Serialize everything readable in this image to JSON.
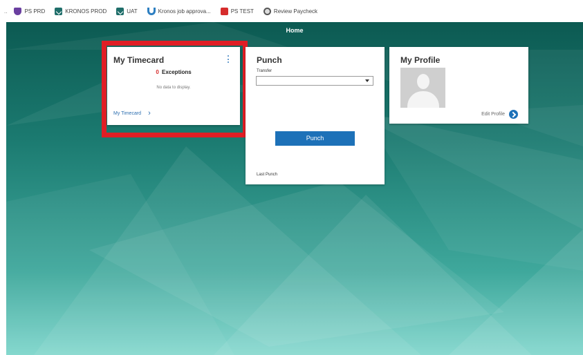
{
  "bookmarks": {
    "overflow": "..",
    "items": [
      {
        "label": "PS PRD",
        "icon": "shield-icon"
      },
      {
        "label": "KRONOS PROD",
        "icon": "kronos-icon"
      },
      {
        "label": "UAT",
        "icon": "kronos-icon"
      },
      {
        "label": "Kronos job approva...",
        "icon": "magnet-icon"
      },
      {
        "label": "PS TEST",
        "icon": "red-square-icon"
      },
      {
        "label": "Review Paycheck",
        "icon": "globe-icon"
      }
    ]
  },
  "header": {
    "title": "Home"
  },
  "timecard": {
    "title": "My Timecard",
    "exceptions_count": "0",
    "exceptions_label": "Exceptions",
    "no_data": "No data to display.",
    "link_label": "My Timecard",
    "link_chevron": "›"
  },
  "punch": {
    "title": "Punch",
    "transfer_label": "Transfer",
    "transfer_value": "",
    "button_label": "Punch",
    "last_punch_label": "Last Punch"
  },
  "profile": {
    "title": "My Profile",
    "edit_label": "Edit Profile"
  },
  "colors": {
    "accent": "#1d71b8",
    "highlight": "#e01e25",
    "exception": "#d62c2c",
    "background_dark": "#0c5a52",
    "background_light": "#7fd6cc"
  }
}
